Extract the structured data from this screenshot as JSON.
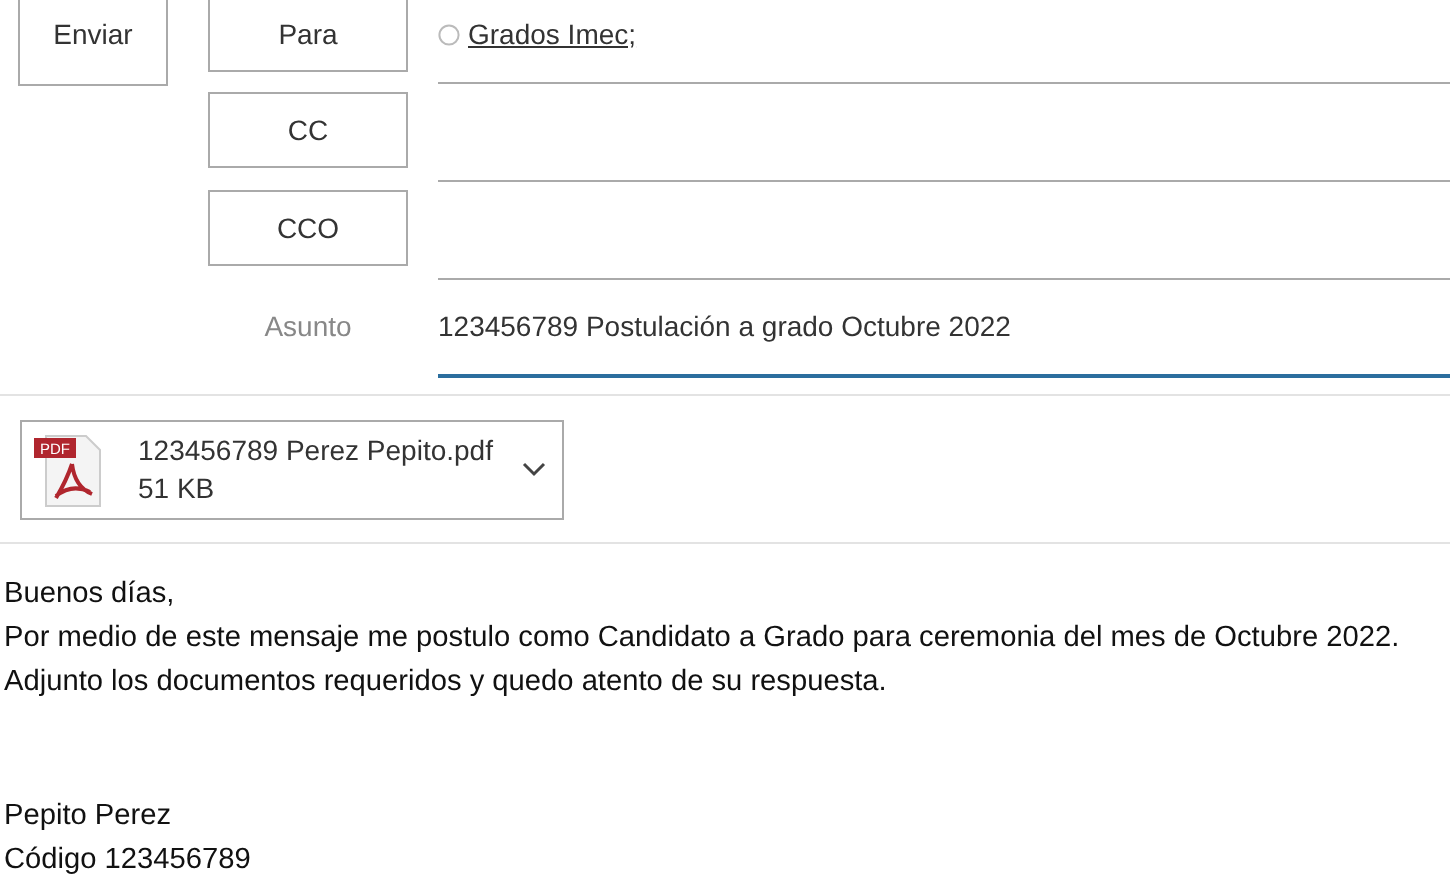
{
  "send_button": "Enviar",
  "fields": [
    {
      "kind": "recipients",
      "label": "Para",
      "recipients": [
        "Grados Imec;"
      ]
    },
    {
      "kind": "recipients",
      "label": "CC"
    },
    {
      "kind": "recipients",
      "label": "CCO"
    },
    {
      "kind": "subject",
      "label": "Asunto",
      "value": "123456789 Postulación a grado Octubre 2022"
    }
  ],
  "attachment": {
    "name": "123456789 Perez Pepito.pdf",
    "size": "51 KB",
    "icon_label": "PDF"
  },
  "body": {
    "lines": [
      "Buenos días,",
      "Por medio de este mensaje me postulo como Candidato a Grado para ceremonia del mes de Octubre 2022.",
      "Adjunto los documentos requeridos y quedo atento de su respuesta."
    ],
    "signature": [
      "Pepito Perez",
      "Código 123456789"
    ]
  }
}
